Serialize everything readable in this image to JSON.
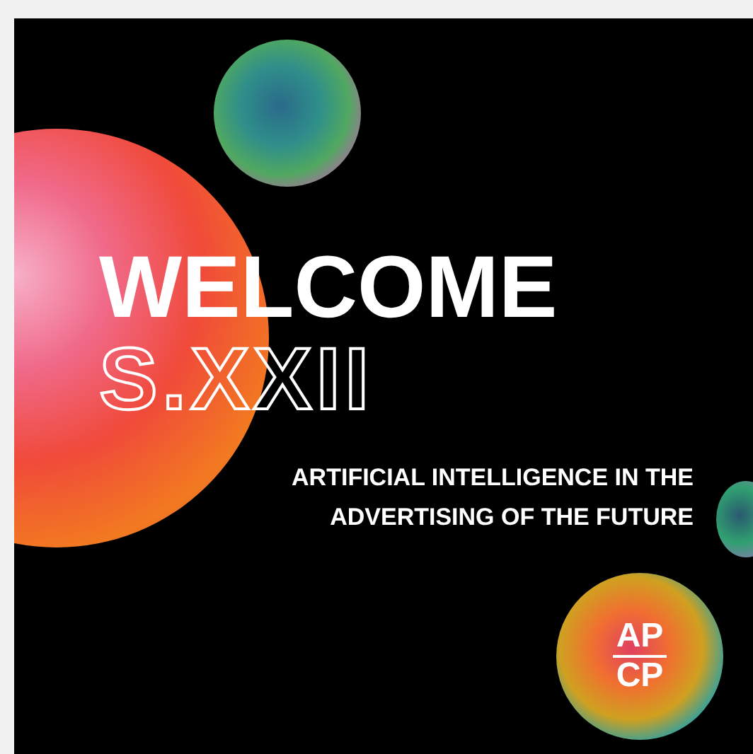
{
  "poster": {
    "headline": "WELCOME",
    "subheadline": "S.XXII",
    "tagline_lines": [
      "ARTIFICIAL INTELLIGENCE IN THE",
      "ADVERTISING OF THE FUTURE"
    ],
    "logo": {
      "top": "AP",
      "bottom": "CP"
    }
  }
}
